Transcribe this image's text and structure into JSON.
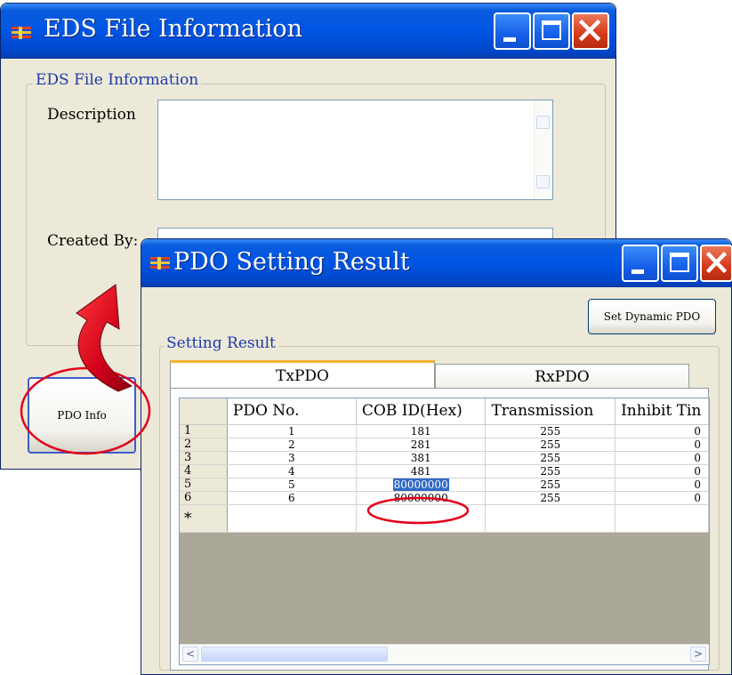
{
  "eds_window": {
    "title": "EDS File Information",
    "group_label": "EDS File Information",
    "description_label": "Description",
    "description_value": "",
    "created_by_label": "Created By:",
    "created_by_value": "",
    "pdo_info_button": "PDO Info"
  },
  "pdo_window": {
    "title": "PDO Setting Result",
    "set_dynamic_button": "Set Dynamic PDO",
    "group_label": "Setting Result",
    "tabs": [
      {
        "label": "TxPDO",
        "active": true
      },
      {
        "label": "RxPDO",
        "active": false
      }
    ],
    "columns": [
      "PDO No.",
      "COB ID(Hex)",
      "Transmission",
      "Inhibit Tin"
    ],
    "rows": [
      {
        "row_header": "1",
        "pdo_no": "1",
        "cob_id": "181",
        "transmission": "255",
        "inhibit": "0"
      },
      {
        "row_header": "2",
        "pdo_no": "2",
        "cob_id": "281",
        "transmission": "255",
        "inhibit": "0"
      },
      {
        "row_header": "3",
        "pdo_no": "3",
        "cob_id": "381",
        "transmission": "255",
        "inhibit": "0"
      },
      {
        "row_header": "4",
        "pdo_no": "4",
        "cob_id": "481",
        "transmission": "255",
        "inhibit": "0"
      },
      {
        "row_header": "5",
        "pdo_no": "5",
        "cob_id": "80000000",
        "transmission": "255",
        "inhibit": "0"
      },
      {
        "row_header": "6",
        "pdo_no": "6",
        "cob_id": "80000000",
        "transmission": "255",
        "inhibit": "0"
      }
    ],
    "new_row_marker": "*",
    "scroll_left": "<",
    "scroll_right": ">"
  },
  "colors": {
    "titlebar": "#0054e3",
    "window_bg": "#ece9d8",
    "annotation_red": "#e2001a",
    "selection": "#316ac5"
  },
  "icons": [
    "app-icon",
    "minimize-icon",
    "maximize-icon",
    "close-icon",
    "curved-arrow-icon",
    "highlight-ellipse"
  ]
}
